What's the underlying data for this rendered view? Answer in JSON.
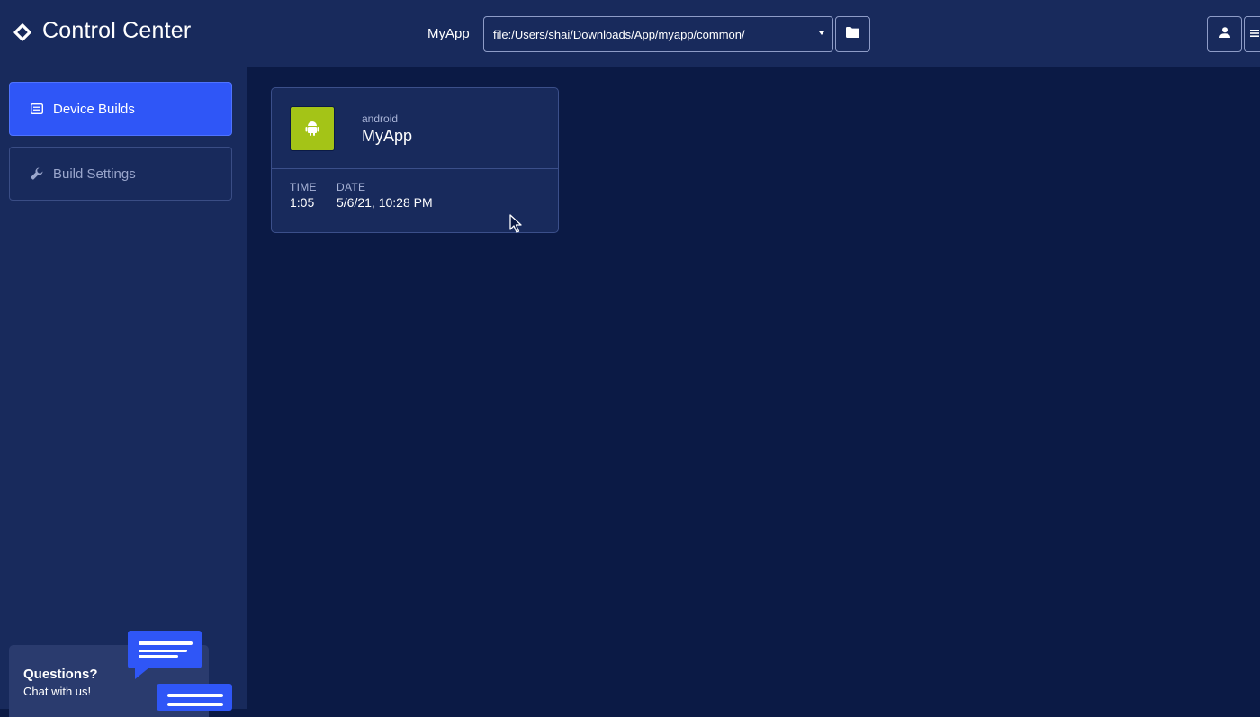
{
  "header": {
    "title": "Control Center",
    "logo_icon": "diamond-logo-icon",
    "project_label": "MyApp",
    "path_select": {
      "value": "file:/Users/shai/Downloads/App/myapp/common/"
    },
    "folder_icon": "folder-icon",
    "user_icon": "user-icon",
    "menu_icon": "menu-icon"
  },
  "sidebar": {
    "items": [
      {
        "label": "Device Builds",
        "icon": "list-icon",
        "active": true
      },
      {
        "label": "Build Settings",
        "icon": "wrench-icon",
        "active": false
      }
    ],
    "chat": {
      "title": "Questions?",
      "subtitle": "Chat with us!",
      "icon": "chat-bubble-icon"
    }
  },
  "main": {
    "builds": [
      {
        "platform": "android",
        "platform_icon": "android-icon",
        "platform_color": "#a4c417",
        "name": "MyApp",
        "time_label": "TIME",
        "time_value": "1:05",
        "date_label": "DATE",
        "date_value": "5/6/21, 10:28 PM"
      }
    ]
  },
  "colors": {
    "background": "#0b1a45",
    "panel": "#182a5c",
    "accent": "#2f56f7"
  }
}
